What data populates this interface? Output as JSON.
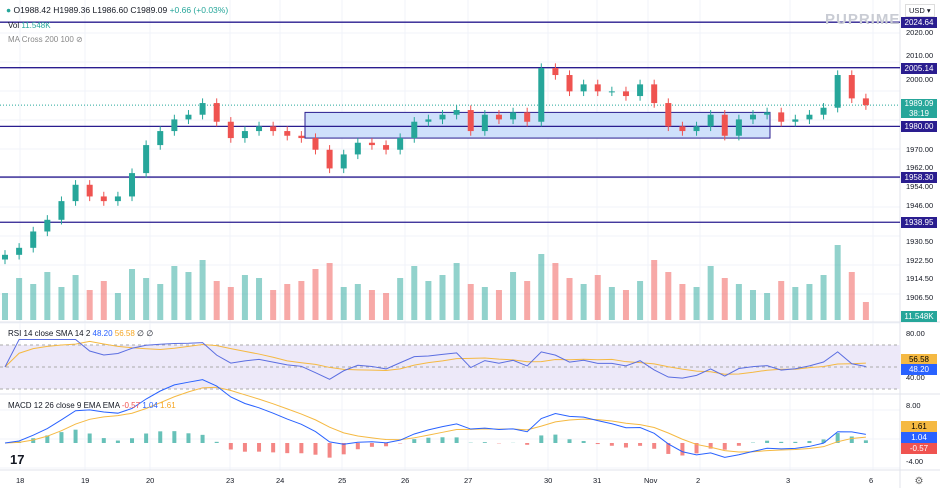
{
  "header": {
    "o": "O1988.42",
    "h": "H1989.36",
    "l": "L1986.60",
    "c": "C1989.09",
    "chg": "+0.66 (+0.03%)",
    "vol_label": "Vol",
    "vol_value": "11.548K",
    "ma": "MA Cross 200 100"
  },
  "currency": "USD",
  "brand": "PUPRIME",
  "colors": {
    "up": "#26a69a",
    "down": "#ef5350",
    "level": "#2a1d8f",
    "rsi": "#5b6ee1",
    "sma": "#f5b942",
    "zone": "#cfe0fb"
  },
  "price_axis": [
    "2020.00",
    "2010.00",
    "2000.00",
    "1970.00",
    "1962.00",
    "1954.00",
    "1946.00",
    "1930.50",
    "1922.50",
    "1914.50",
    "1906.50"
  ],
  "levels": [
    "2024.64",
    "2005.14",
    "1980.00",
    "1958.30",
    "1938.95"
  ],
  "last": {
    "price": "1989.09",
    "countdown": "38:19",
    "volume": "11.548K"
  },
  "rsi": {
    "label": "RSI 14 close SMA 14 2",
    "v1": "48.20",
    "v2": "56.58",
    "extra": "∅ ∅",
    "axis": [
      "80.00",
      "40.00"
    ]
  },
  "macd": {
    "label": "MACD 12 26 close 9 EMA EMA",
    "hist": "-0.57",
    "macd": "1.04",
    "signal": "1.61",
    "axis": [
      "8.00",
      "-4.00"
    ]
  },
  "dates": [
    "18",
    "19",
    "20",
    "23",
    "24",
    "25",
    "26",
    "27",
    "30",
    "31",
    "Nov",
    "2",
    "3",
    "6"
  ],
  "chart_data": {
    "type": "candlestick",
    "price_range": [
      1900,
      2030
    ],
    "zone": [
      1975,
      1986
    ],
    "closes": [
      1925,
      1928,
      1935,
      1940,
      1948,
      1955,
      1950,
      1948,
      1950,
      1960,
      1972,
      1978,
      1983,
      1985,
      1990,
      1982,
      1975,
      1978,
      1980,
      1978,
      1976,
      1975,
      1970,
      1962,
      1968,
      1973,
      1972,
      1970,
      1975,
      1982,
      1983,
      1985,
      1987,
      1978,
      1985,
      1983,
      1986,
      1982,
      2005,
      2002,
      1995,
      1998,
      1995,
      1995,
      1993,
      1998,
      1990,
      1980,
      1978,
      1980,
      1985,
      1976,
      1983,
      1985,
      1986,
      1982,
      1983,
      1985,
      1988,
      2002,
      1992,
      1989.09
    ],
    "volume": [
      9,
      14,
      12,
      16,
      11,
      15,
      10,
      13,
      9,
      17,
      14,
      12,
      18,
      16,
      20,
      13,
      11,
      15,
      14,
      10,
      12,
      13,
      17,
      19,
      11,
      12,
      10,
      9,
      14,
      18,
      13,
      15,
      19,
      12,
      11,
      10,
      16,
      13,
      22,
      19,
      14,
      12,
      15,
      11,
      10,
      13,
      20,
      16,
      12,
      11,
      18,
      14,
      12,
      10,
      9,
      13,
      11,
      12,
      15,
      25,
      16,
      6
    ]
  }
}
